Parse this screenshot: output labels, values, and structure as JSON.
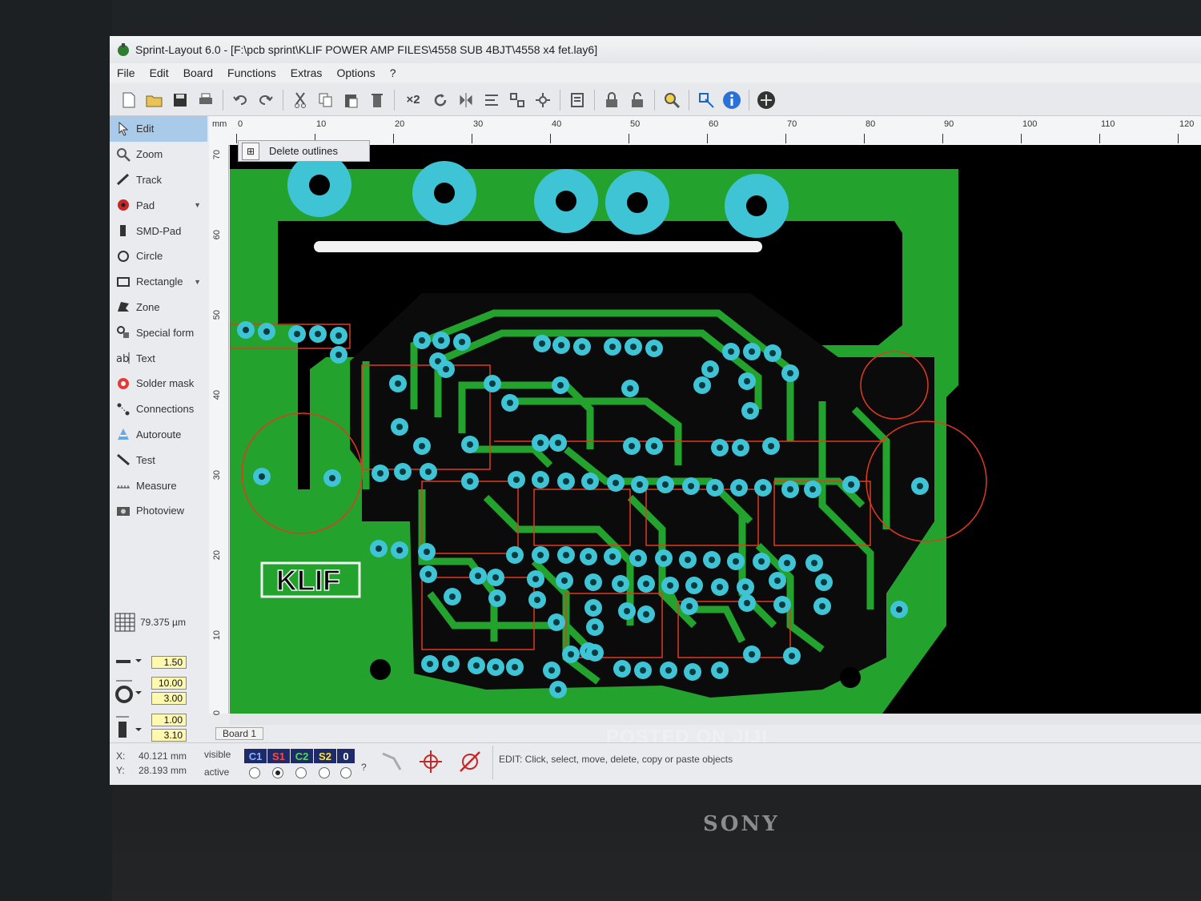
{
  "window": {
    "title": "Sprint-Layout 6.0 - [F:\\pcb sprint\\KLIF POWER AMP FILES\\4558 SUB 4BJT\\4558 x4 fet.lay6]"
  },
  "menu": [
    "File",
    "Edit",
    "Board",
    "Functions",
    "Extras",
    "Options",
    "?"
  ],
  "toolbar": {
    "zoom_x2": "×2"
  },
  "tools": [
    {
      "label": "Edit",
      "icon": "cursor-icon",
      "active": true
    },
    {
      "label": "Zoom",
      "icon": "zoom-icon"
    },
    {
      "label": "Track",
      "icon": "track-icon"
    },
    {
      "label": "Pad",
      "icon": "pad-icon",
      "dropdown": true
    },
    {
      "label": "SMD-Pad",
      "icon": "smd-pad-icon"
    },
    {
      "label": "Circle",
      "icon": "circle-icon"
    },
    {
      "label": "Rectangle",
      "icon": "rectangle-icon",
      "dropdown": true
    },
    {
      "label": "Zone",
      "icon": "zone-icon"
    },
    {
      "label": "Special form",
      "icon": "special-form-icon"
    },
    {
      "label": "Text",
      "icon": "text-icon"
    },
    {
      "label": "Solder mask",
      "icon": "solder-mask-icon"
    },
    {
      "label": "Connections",
      "icon": "connections-icon"
    },
    {
      "label": "Autoroute",
      "icon": "autoroute-icon"
    },
    {
      "label": "Test",
      "icon": "test-icon"
    },
    {
      "label": "Measure",
      "icon": "measure-icon"
    },
    {
      "label": "Photoview",
      "icon": "photoview-icon"
    }
  ],
  "grid": {
    "value": "79.375 µm"
  },
  "params": {
    "track_width": "1.50",
    "pad_outer": "10.00",
    "pad_inner": "3.00",
    "smd_w": "1.00",
    "smd_h": "3.10"
  },
  "ruler": {
    "unit": "mm",
    "top_ticks": [
      "0",
      "10",
      "20",
      "30",
      "40",
      "50",
      "60",
      "70",
      "80",
      "90",
      "100",
      "110",
      "120"
    ],
    "left_ticks": [
      "70",
      "60",
      "50",
      "40",
      "30",
      "20",
      "10",
      "0"
    ]
  },
  "dialog": {
    "label": "Delete outlines"
  },
  "board": {
    "text": "KLIF",
    "copper": "#23a32e",
    "pad": "#3fc4d6",
    "outline": "#e03a1e"
  },
  "tab": {
    "label": "Board 1"
  },
  "status": {
    "x_label": "X:",
    "x": "40.121 mm",
    "y_label": "Y:",
    "y": "28.193 mm",
    "visible": "visible",
    "active": "active",
    "layers": [
      "C1",
      "S1",
      "C2",
      "S2",
      "0"
    ],
    "hint": "EDIT:  Click, select, move, delete, copy or paste objects",
    "help": "?"
  },
  "watermark": "POSTED ON JIJI",
  "brand": "SONY"
}
